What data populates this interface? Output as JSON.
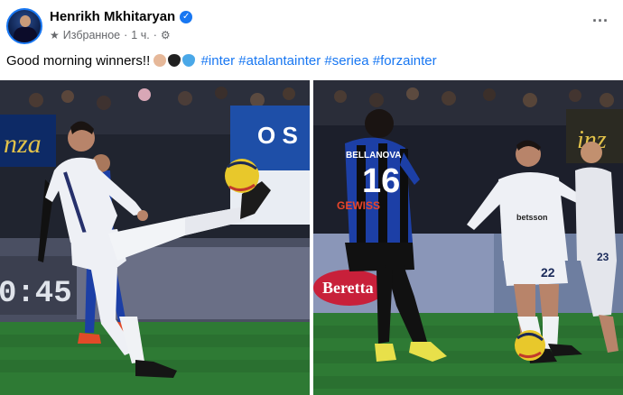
{
  "post": {
    "author": "Henrikh Mkhitaryan",
    "meta_audience": "Избранное",
    "meta_separator": "·",
    "meta_time": "1 ч.",
    "meta_separator2": "·",
    "caption_text": "Good morning winners!! ",
    "hashtags": [
      "#inter",
      "#atalantainter",
      "#seriea",
      "#forzainter"
    ],
    "emoji_colors": [
      "#e6b899",
      "#202020",
      "#4aa8e8"
    ]
  },
  "photos": {
    "left": {
      "board_text_top": "nza",
      "board_text_mid": "O S",
      "scoreboard": "0:45",
      "player_number": "",
      "shirt_logo": ""
    },
    "right": {
      "board_text_top": "inz",
      "opponent_name": "BELLANOVA",
      "opponent_number": "16",
      "opponent_sponsor": "GEWISS",
      "ad_text": "Beretta",
      "player_number": "22",
      "back_number": "23",
      "player_sponsor": "betsson"
    }
  },
  "colors": {
    "accent": "#1877f2",
    "secondary_text": "#65676b",
    "pitch": "#2e7a34",
    "inter_kit": "#eef0f5",
    "atalanta_blue": "#1c3fa6"
  },
  "icons": {
    "verified": "verified-badge-icon",
    "audience": "star-icon",
    "privacy": "gear-icon",
    "more": "more-dots-icon"
  }
}
